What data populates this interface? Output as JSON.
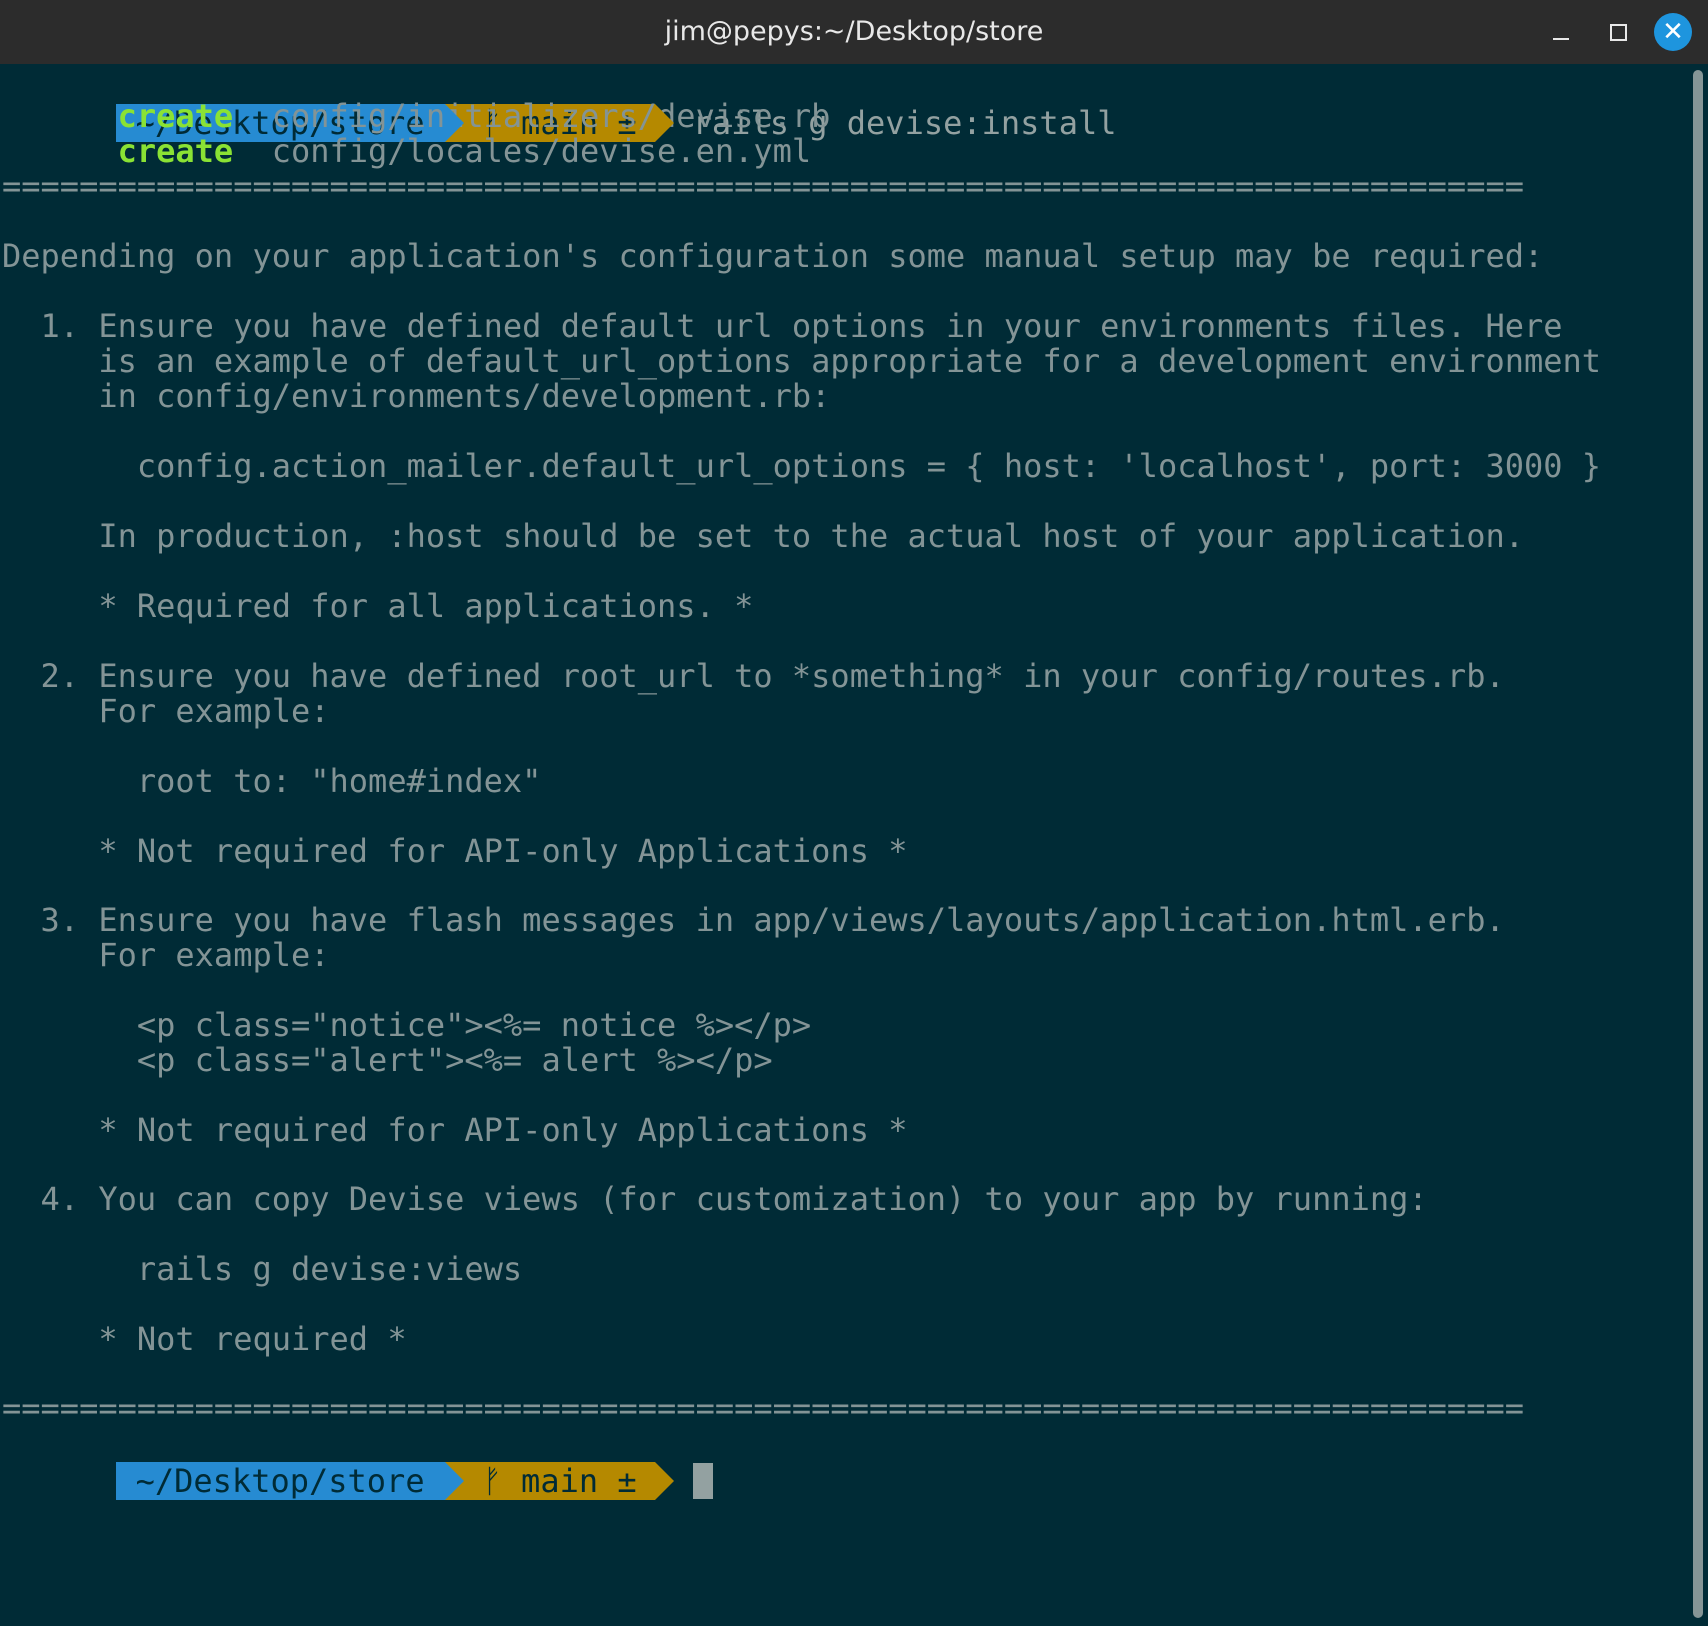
{
  "window": {
    "title": "jim@pepys:~/Desktop/store"
  },
  "prompt": {
    "dir": "~/Desktop/store",
    "branch_icon": "ᚠ",
    "branch": "main ±",
    "command": "rails g devise:install"
  },
  "output": {
    "create1_verb": "create",
    "create1_path": "config/initializers/devise.rb",
    "create2_verb": "create",
    "create2_path": "config/locales/devise.en.yml",
    "rule": "===============================================================================",
    "intro": "Depending on your application's configuration some manual setup may be required:",
    "s1_a": "  1. Ensure you have defined default url options in your environments files. Here",
    "s1_b": "     is an example of default_url_options appropriate for a development environment",
    "s1_c": "     in config/environments/development.rb:",
    "s1_code": "       config.action_mailer.default_url_options = { host: 'localhost', port: 3000 }",
    "s1_prod": "     In production, :host should be set to the actual host of your application.",
    "s1_note": "     * Required for all applications. *",
    "s2_a": "  2. Ensure you have defined root_url to *something* in your config/routes.rb.",
    "s2_b": "     For example:",
    "s2_code": "       root to: \"home#index\"",
    "s2_note": "     * Not required for API-only Applications *",
    "s3_a": "  3. Ensure you have flash messages in app/views/layouts/application.html.erb.",
    "s3_b": "     For example:",
    "s3_code1": "       <p class=\"notice\"><%= notice %></p>",
    "s3_code2": "       <p class=\"alert\"><%= alert %></p>",
    "s3_note": "     * Not required for API-only Applications *",
    "s4_a": "  4. You can copy Devise views (for customization) to your app by running:",
    "s4_code": "       rails g devise:views",
    "s4_note": "     * Not required *",
    "rule2": "==============================================================================="
  },
  "prompt2": {
    "dir": "~/Desktop/store",
    "branch_icon": "ᚠ",
    "branch": "main ±"
  },
  "colors": {
    "background": "#002b36",
    "text": "#839496",
    "dir_segment": "#268bd2",
    "git_segment": "#b58900",
    "create_green": "#8ae234",
    "close_button": "#1e95de"
  }
}
